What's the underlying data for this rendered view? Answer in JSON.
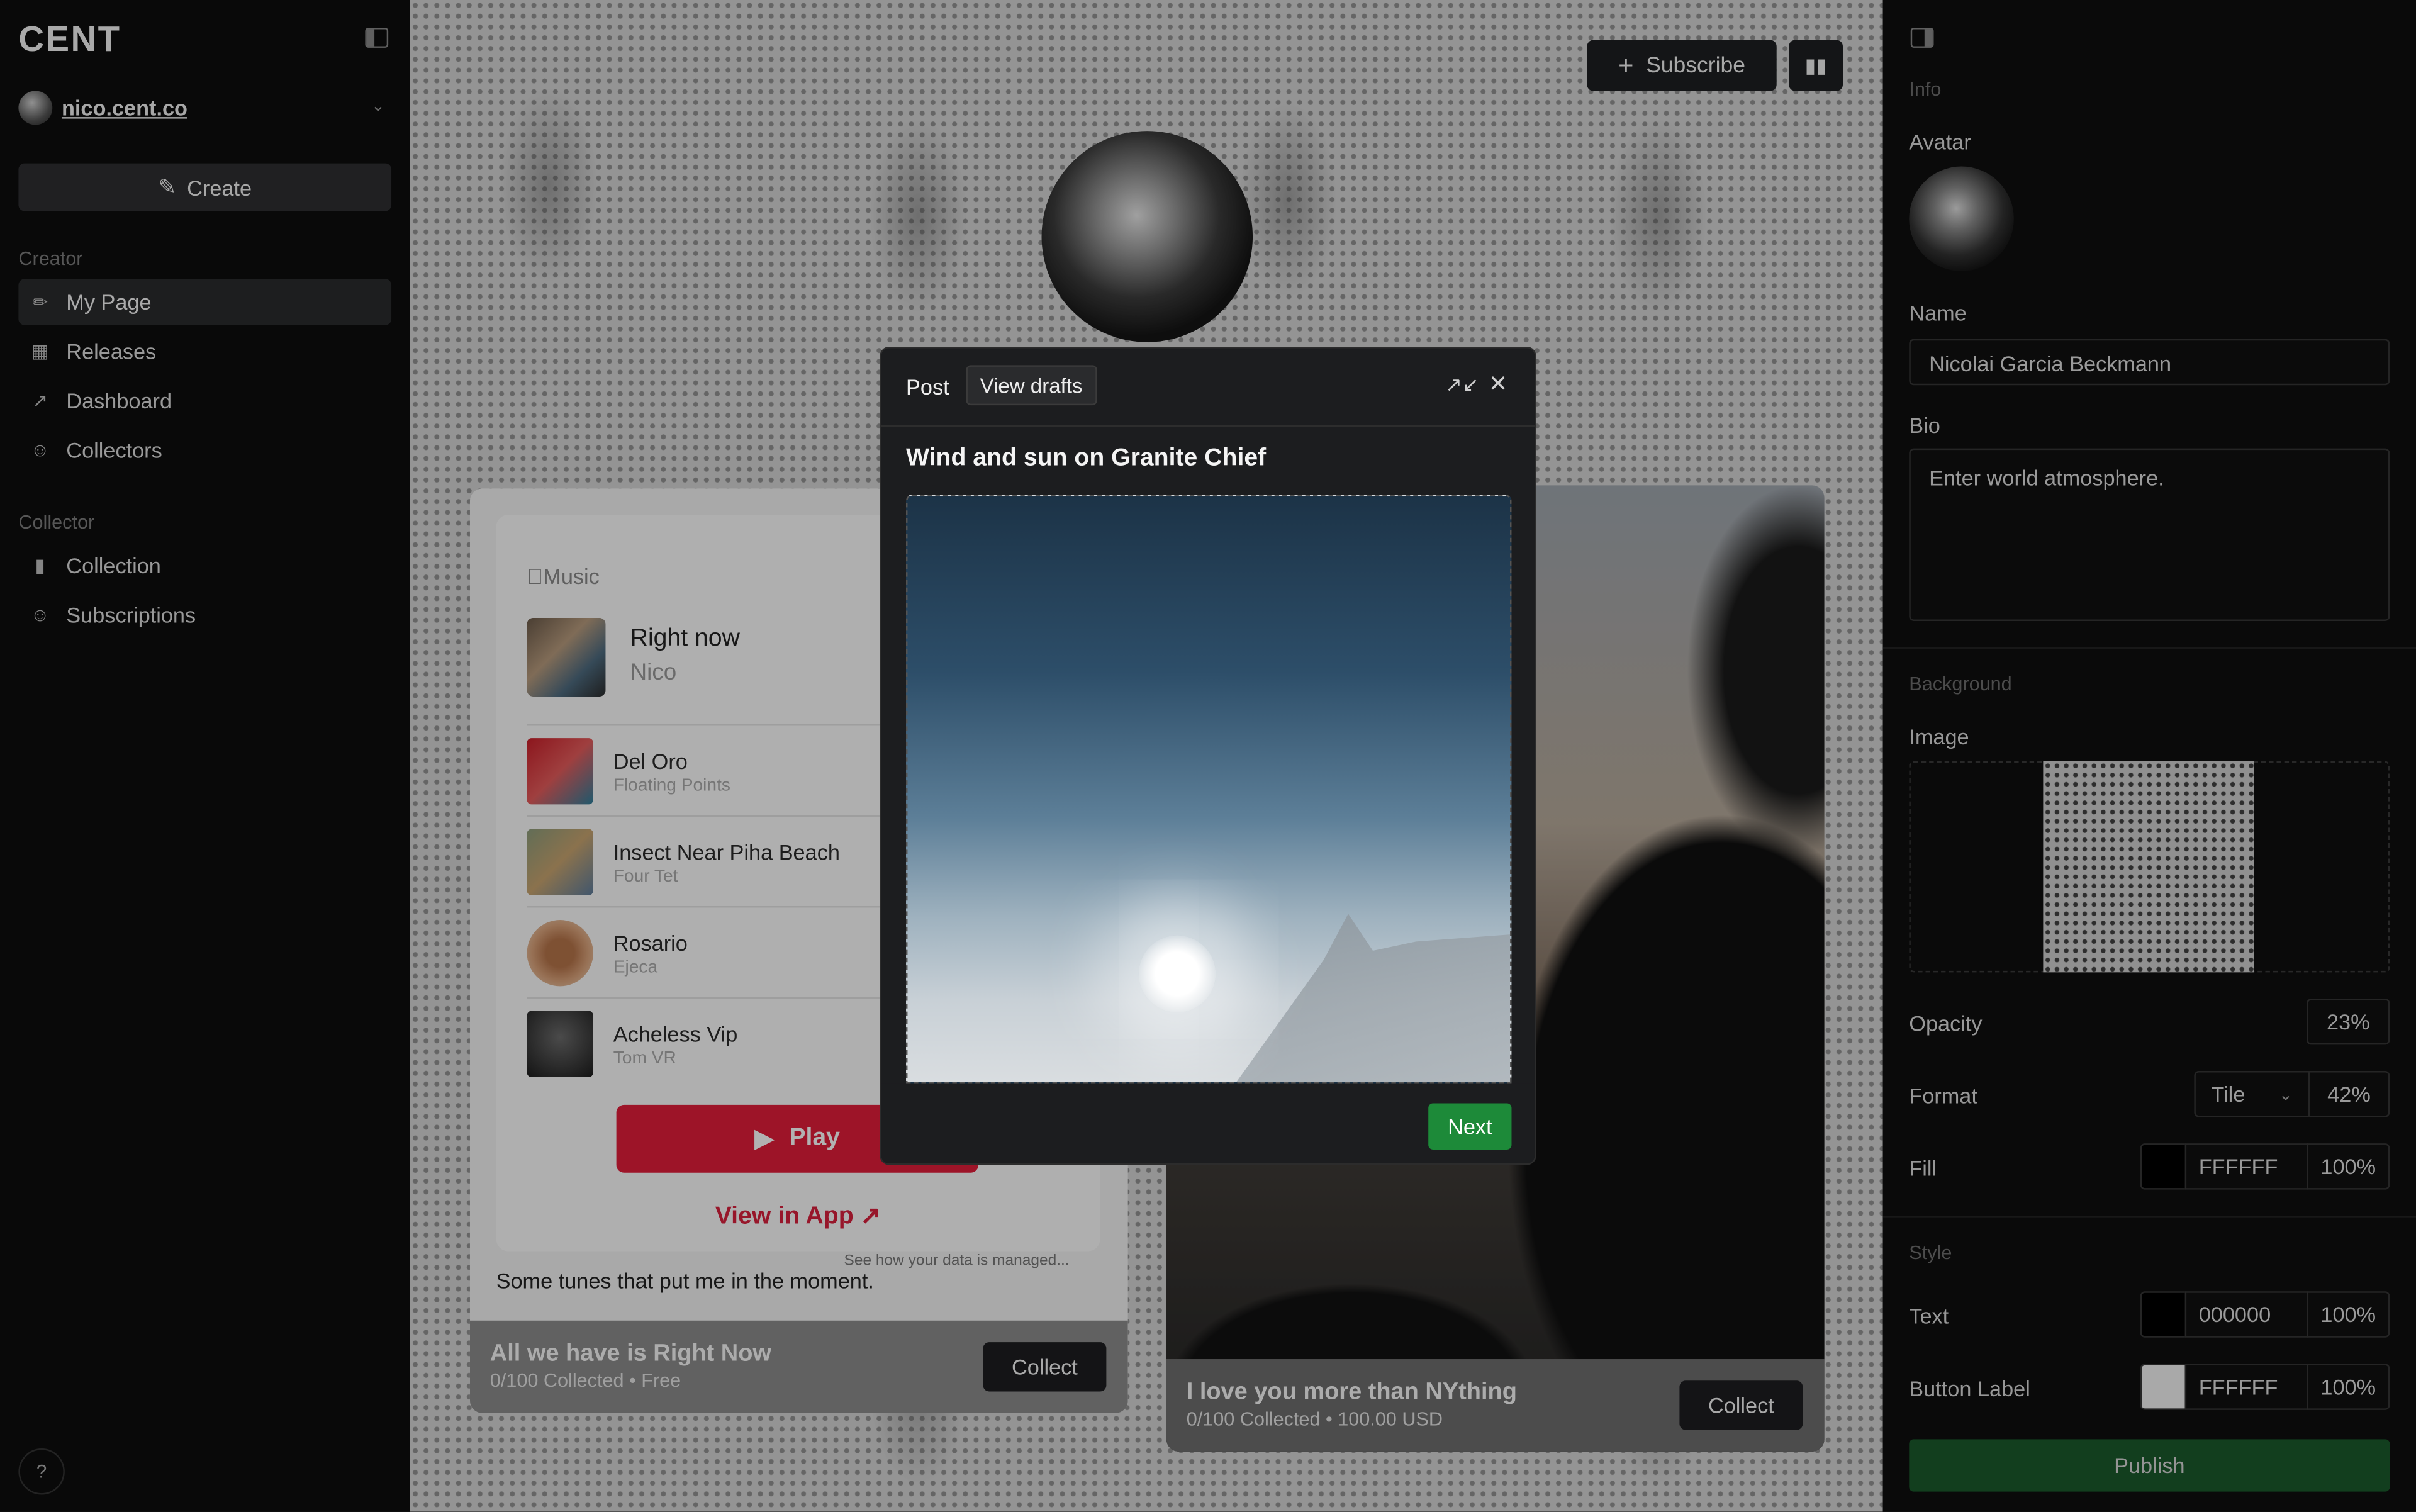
{
  "sidebar": {
    "logo": "CENT",
    "account": "nico.cent.co",
    "create_label": "Create",
    "creator_section": "Creator",
    "creator_items": [
      {
        "label": "My Page",
        "icon": "brush-icon"
      },
      {
        "label": "Releases",
        "icon": "releases-icon"
      },
      {
        "label": "Dashboard",
        "icon": "chart-icon"
      },
      {
        "label": "Collectors",
        "icon": "users-icon"
      }
    ],
    "collector_section": "Collector",
    "collector_items": [
      {
        "label": "Collection",
        "icon": "collection-icon"
      },
      {
        "label": "Subscriptions",
        "icon": "users-icon"
      }
    ],
    "help_label": "?"
  },
  "canvas": {
    "subscribe_label": "Subscribe",
    "music_card": {
      "brand": "Music",
      "now_title": "Right now",
      "now_artist": "Nico",
      "tracks": [
        {
          "title": "Del Oro",
          "artist": "Floating Points"
        },
        {
          "title": "Insect Near Piha Beach",
          "artist": "Four Tet"
        },
        {
          "title": "Rosario",
          "artist": "Ejeca"
        },
        {
          "title": "Acheless Vip",
          "artist": "Tom VR"
        }
      ],
      "play_label": "Play",
      "view_in_app": "View in App",
      "data_note": "See how your data is managed...",
      "description": "Some tunes that put me in the moment.",
      "footer_title": "All we have is Right Now",
      "footer_sub": "0/100 Collected • Free",
      "collect_label": "Collect"
    },
    "photo_card": {
      "footer_title": "I love you more than NYthing",
      "footer_sub": "0/100 Collected • 100.00 USD",
      "collect_label": "Collect"
    }
  },
  "modal": {
    "tab_label": "Post",
    "drafts_label": "View drafts",
    "title": "Wind and sun on Granite Chief",
    "next_label": "Next"
  },
  "panel": {
    "info_section": "Info",
    "avatar_label": "Avatar",
    "name_label": "Name",
    "name_value": "Nicolai Garcia Beckmann",
    "bio_label": "Bio",
    "bio_value": "Enter world atmosphere.",
    "background_section": "Background",
    "image_label": "Image",
    "opacity_label": "Opacity",
    "opacity_value": "23%",
    "format_label": "Format",
    "format_value": "Tile",
    "format_percent": "42%",
    "fill_label": "Fill",
    "fill_hex": "FFFFFF",
    "fill_percent": "100%",
    "style_section": "Style",
    "text_label": "Text",
    "text_hex": "000000",
    "text_percent": "100%",
    "button_label_label": "Button Label",
    "button_hex": "FFFFFF",
    "button_percent": "100%",
    "publish_label": "Publish"
  },
  "colors": {
    "accent_green": "#1d8a39",
    "apple_red": "#e11d3a",
    "fill_swatch": "#000000",
    "text_swatch": "#000000",
    "button_swatch": "#ffffff"
  }
}
